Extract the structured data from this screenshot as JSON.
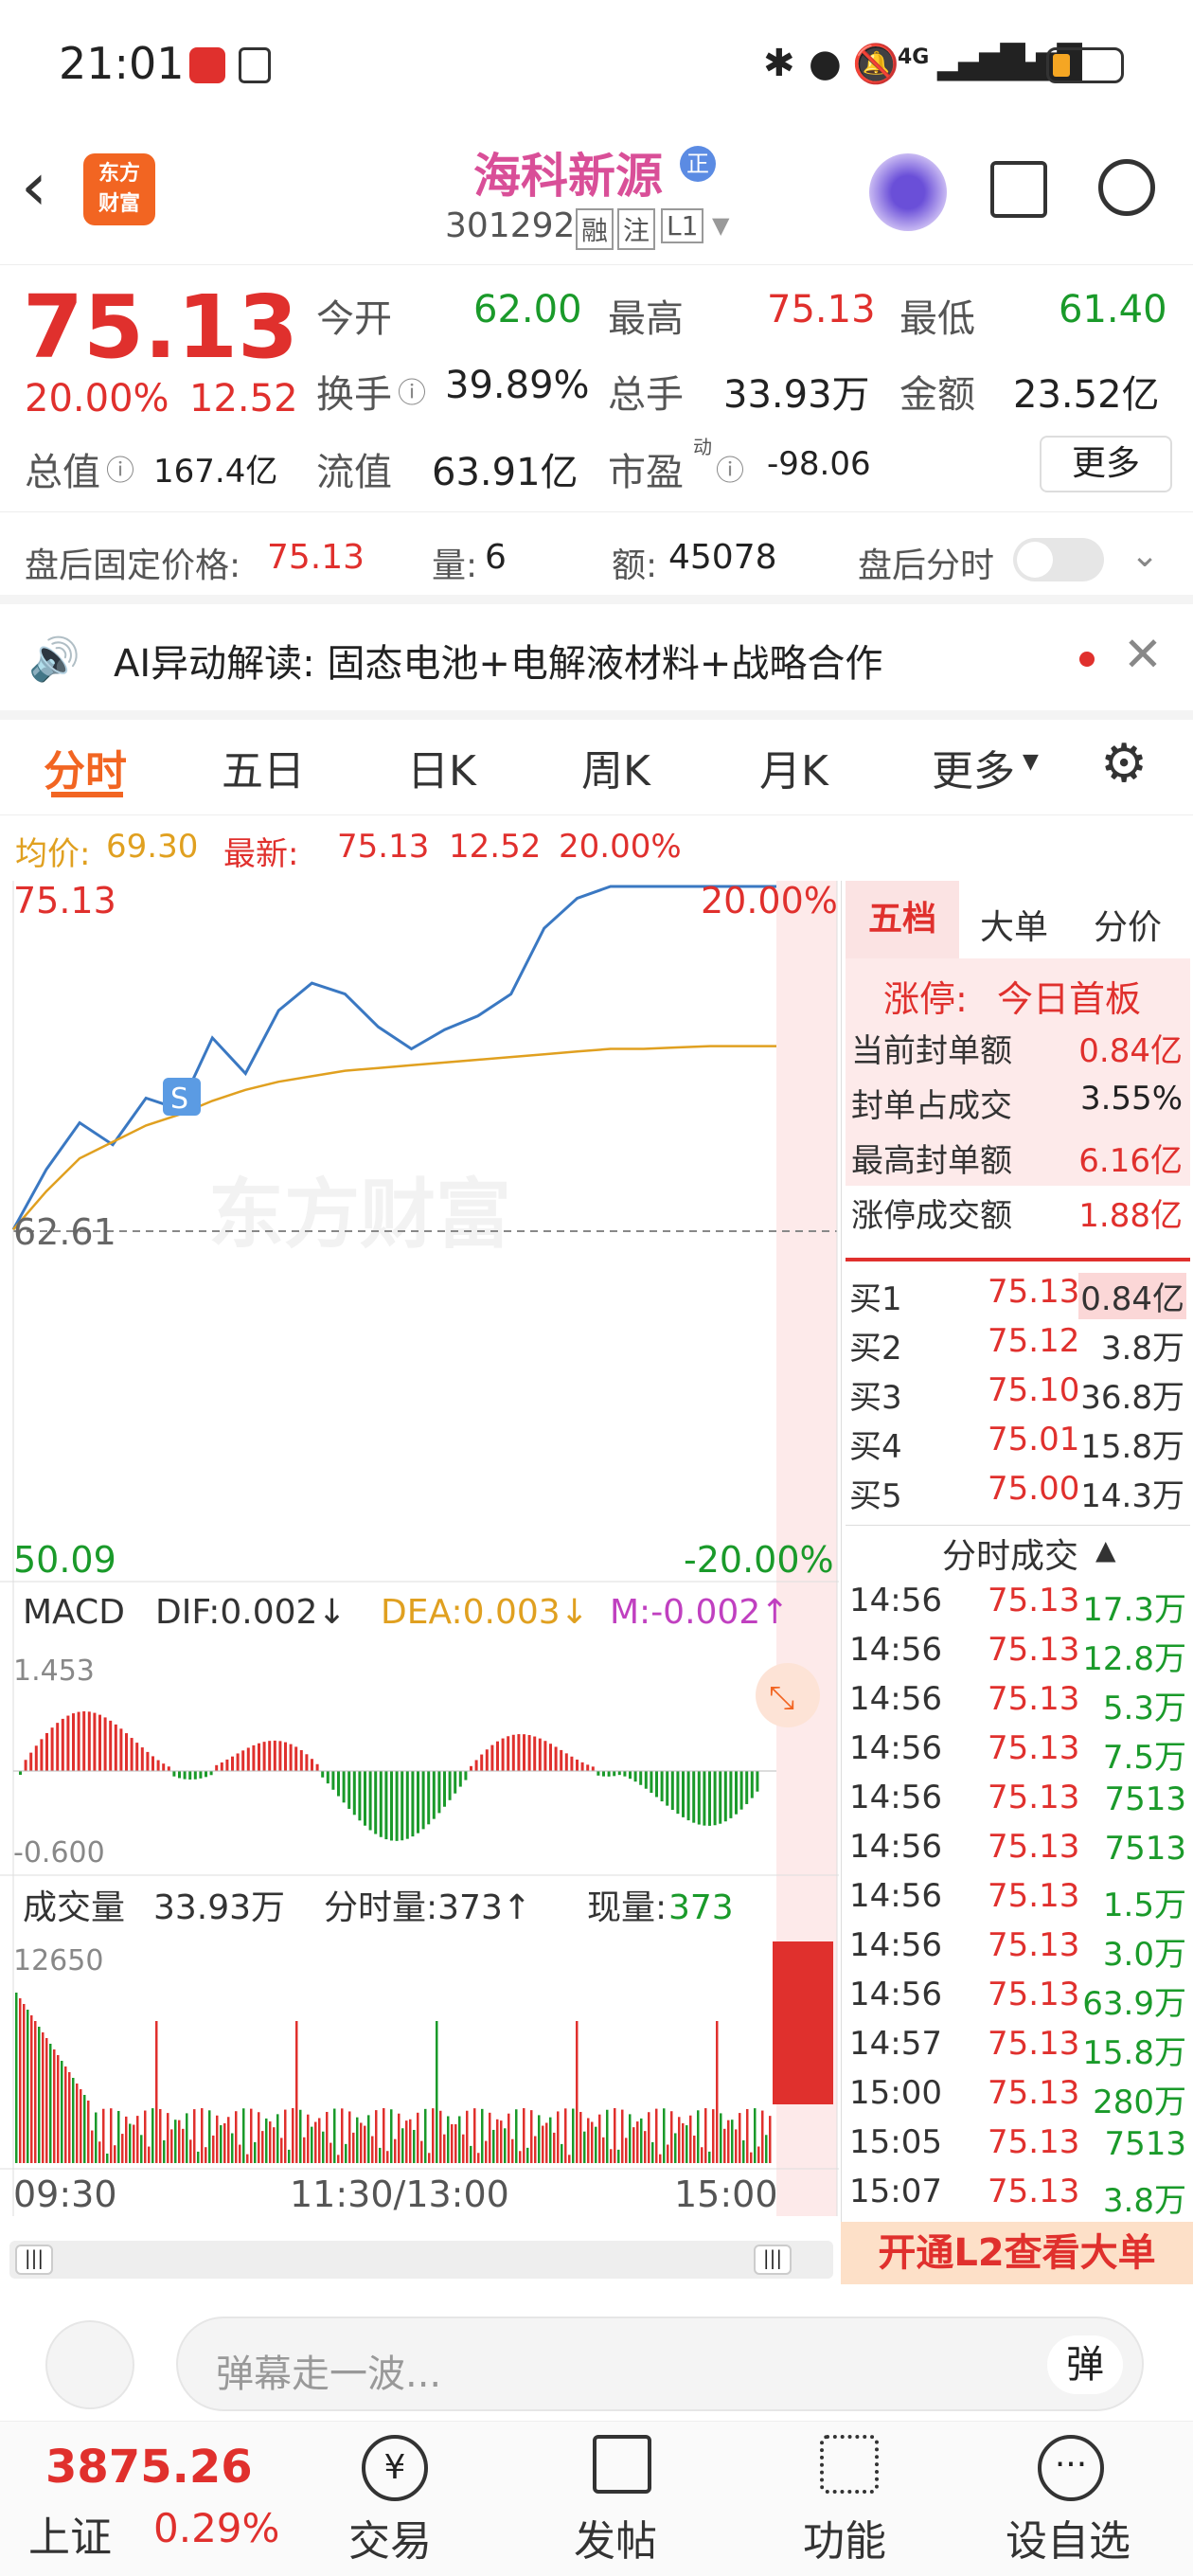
{
  "status": {
    "time": "21:01",
    "net": "4G"
  },
  "nav": {
    "logo_line1": "东方",
    "logo_line2": "财富",
    "stock_name": "海科新源",
    "badge": "正",
    "code": "301292",
    "tag_rong": "融",
    "tag_zhu": "注",
    "tag_level": "L1"
  },
  "quote": {
    "price": "75.13",
    "pct": "20.00%",
    "chg": "12.52",
    "open_label": "今开",
    "open": "62.00",
    "high_label": "最高",
    "high": "75.13",
    "low_label": "最低",
    "low": "61.40",
    "turnover_label": "换手",
    "turnover": "39.89%",
    "vol_label": "总手",
    "vol": "33.93万",
    "amount_label": "金额",
    "amount": "23.52亿",
    "mcap_label": "总值",
    "mcap": "167.4亿",
    "float_label": "流值",
    "float": "63.91亿",
    "pe_label": "市盈",
    "pe_sup": "动",
    "pe": "-98.06",
    "more": "更多"
  },
  "after": {
    "price_label": "盘后固定价格:",
    "price": "75.13",
    "vol_label": "量:",
    "vol": "6",
    "amt_label": "额:",
    "amt": "45078",
    "time_label": "盘后分时"
  },
  "ai": {
    "text": "AI异动解读:  固态电池+电解液材料+战略合作"
  },
  "tabs": [
    "分时",
    "五日",
    "日K",
    "周K",
    "月K",
    "更多"
  ],
  "info": {
    "avg_label": "均价:",
    "avg": "69.30",
    "new_label": "最新:",
    "new": "75.13",
    "chg": "12.52",
    "pct": "20.00%"
  },
  "chart": {
    "top": "75.13",
    "top_pct": "20.00%",
    "mid": "62.61",
    "bottom": "50.09",
    "bottom_pct": "-20.00%",
    "watermark": "东方财富",
    "signal": "S",
    "macd_label": "MACD",
    "dif": "DIF:0.002↓",
    "dea": "DEA:0.003↓",
    "m": "M:-0.002↑",
    "macd_top": "1.453",
    "macd_bottom": "-0.600",
    "vol_label": "成交量",
    "vol_total": "33.93万",
    "fs_label": "分时量:373↑",
    "now_label": "现量:",
    "now": "373",
    "vol_max": "12650",
    "x_labels": [
      "09:30",
      "11:30/13:00",
      "15:00"
    ]
  },
  "chart_data": {
    "type": "line",
    "y_range": [
      50.09,
      75.13
    ],
    "series": [
      {
        "name": "price",
        "values": [
          62.6,
          64.8,
          66.5,
          65.7,
          67.4,
          67.0,
          69.6,
          68.3,
          70.6,
          71.6,
          71.2,
          70.0,
          69.2,
          69.9,
          70.4,
          71.2,
          73.6,
          74.7,
          75.13,
          75.13,
          75.13,
          75.13,
          75.13,
          75.13
        ]
      },
      {
        "name": "avg",
        "values": [
          62.6,
          64.0,
          65.2,
          65.8,
          66.4,
          66.8,
          67.3,
          67.7,
          68.0,
          68.2,
          68.4,
          68.5,
          68.6,
          68.7,
          68.8,
          68.9,
          69.0,
          69.1,
          69.2,
          69.2,
          69.25,
          69.3,
          69.3,
          69.3
        ]
      }
    ]
  },
  "side": {
    "tabs": [
      "五档",
      "大单",
      "分价"
    ],
    "limit_label": "涨停:",
    "limit_val": "今日首板",
    "stats": [
      {
        "k": "当前封单额",
        "v": "0.84亿"
      },
      {
        "k": "封单占成交",
        "v": "3.55%"
      },
      {
        "k": "最高封单额",
        "v": "6.16亿"
      },
      {
        "k": "涨停成交额",
        "v": "1.88亿"
      }
    ],
    "buys": [
      {
        "k": "买1",
        "p": "75.13",
        "v": "0.84亿"
      },
      {
        "k": "买2",
        "p": "75.12",
        "v": "3.8万"
      },
      {
        "k": "买3",
        "p": "75.10",
        "v": "36.8万"
      },
      {
        "k": "买4",
        "p": "75.01",
        "v": "15.8万"
      },
      {
        "k": "买5",
        "p": "75.00",
        "v": "14.3万"
      }
    ],
    "trades_title": "分时成交",
    "trades": [
      {
        "t": "14:56",
        "p": "75.13",
        "v": "17.3万"
      },
      {
        "t": "14:56",
        "p": "75.13",
        "v": "12.8万"
      },
      {
        "t": "14:56",
        "p": "75.13",
        "v": "5.3万"
      },
      {
        "t": "14:56",
        "p": "75.13",
        "v": "7.5万"
      },
      {
        "t": "14:56",
        "p": "75.13",
        "v": "7513"
      },
      {
        "t": "14:56",
        "p": "75.13",
        "v": "7513"
      },
      {
        "t": "14:56",
        "p": "75.13",
        "v": "1.5万"
      },
      {
        "t": "14:56",
        "p": "75.13",
        "v": "3.0万"
      },
      {
        "t": "14:56",
        "p": "75.13",
        "v": "63.9万"
      },
      {
        "t": "14:57",
        "p": "75.13",
        "v": "15.8万"
      },
      {
        "t": "15:00",
        "p": "75.13",
        "v": "280万"
      },
      {
        "t": "15:05",
        "p": "75.13",
        "v": "7513"
      },
      {
        "t": "15:07",
        "p": "75.13",
        "v": "3.8万"
      }
    ],
    "l2": "开通L2查看大单"
  },
  "comment": {
    "placeholder": "弹幕走一波...",
    "danmu": "弹"
  },
  "bottom": {
    "index_val": "3875.26",
    "index_name": "上证",
    "index_pct": "0.29%",
    "items": [
      "交易",
      "发帖",
      "功能",
      "设自选"
    ]
  }
}
